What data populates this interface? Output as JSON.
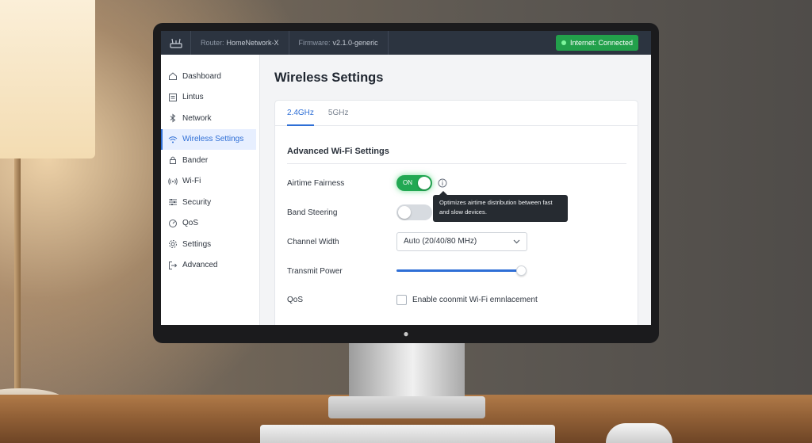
{
  "topbar": {
    "router_label": "Router:",
    "router_value": "HomeNetwork-X",
    "firmware_label": "Firmware:",
    "firmware_value": "v2.1.0-generic",
    "status": "Internet: Connected"
  },
  "sidebar": {
    "items": [
      {
        "label": "Dashboard",
        "icon": "home-icon"
      },
      {
        "label": "Lintus",
        "icon": "list-icon"
      },
      {
        "label": "Network",
        "icon": "bluetooth-icon"
      },
      {
        "label": "Wireless Settings",
        "icon": "wifi-icon",
        "active": true
      },
      {
        "label": "Bander",
        "icon": "lock-icon"
      },
      {
        "label": "Wi-Fi",
        "icon": "signal-icon"
      },
      {
        "label": "Security",
        "icon": "sliders-icon"
      },
      {
        "label": "QoS",
        "icon": "gauge-icon"
      },
      {
        "label": "Settings",
        "icon": "gear-icon"
      },
      {
        "label": "Advanced",
        "icon": "logout-icon"
      }
    ]
  },
  "main": {
    "title": "Wireless Settings",
    "tabs": [
      {
        "label": "2.4GHz",
        "active": true
      },
      {
        "label": "5GHz",
        "active": false
      }
    ],
    "section_title": "Advanced Wi-Fi Settings",
    "airtime_fairness": {
      "label": "Airtime Fairness",
      "state": "ON",
      "enabled": true
    },
    "tooltip": "Optimizes airtime distribution between fast and slow devices.",
    "band_steering": {
      "label": "Band Steering",
      "enabled": false
    },
    "channel_width": {
      "label": "Channel Width",
      "value": "Auto (20/40/80 MHz)"
    },
    "transmit_power": {
      "label": "Transmit Power",
      "level_percent": 98
    },
    "qos": {
      "label": "QoS",
      "checkbox_label": "Enable coonmit Wi-Fi emnlacement",
      "checked": false
    }
  },
  "colors": {
    "accent": "#2f6fd6",
    "topbar": "#2c3440",
    "status_green": "#22a04b"
  }
}
